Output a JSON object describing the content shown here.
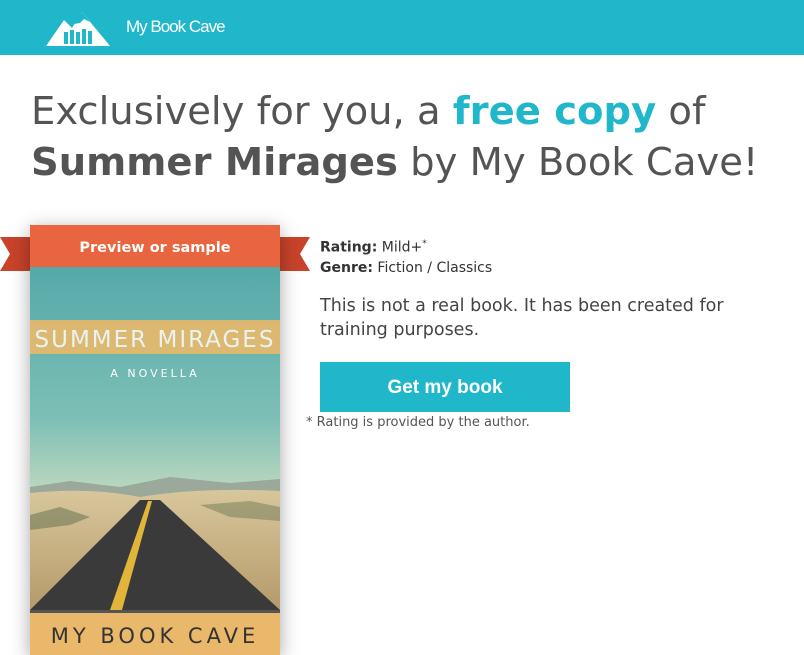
{
  "header": {
    "brand": "My Book Cave",
    "logo_icon": "mountain-books-logo"
  },
  "headline": {
    "part1": "Exclusively for you, a ",
    "accent": "free copy",
    "part2": " of",
    "book_title": "Summer Mirages",
    "part3": " by My Book Cave!"
  },
  "book": {
    "ribbon_label": "Preview or sample",
    "cover_title": "SUMMER MIRAGES",
    "cover_subtitle": "A NOVELLA",
    "cover_author": "MY BOOK CAVE"
  },
  "details": {
    "rating_label": "Rating:",
    "rating_value": "Mild+",
    "rating_mark": "*",
    "genre_label": "Genre:",
    "genre_value": "Fiction / Classics"
  },
  "description": "This is not a real book. It has been created for training purposes.",
  "cta": {
    "label": "Get my book"
  },
  "footnote": {
    "mark": "*",
    "text": "Rating is provided by the author."
  },
  "colors": {
    "brand": "#1fb7c9",
    "ribbon": "#ef5f3f",
    "cover_band": "#e9b86a"
  }
}
